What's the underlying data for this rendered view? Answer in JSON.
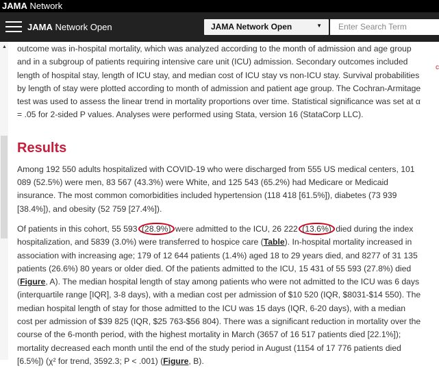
{
  "topbar": {
    "brand_bold": "JAMA",
    "brand_rest": " Network"
  },
  "navbar": {
    "journal_bold": "JAMA",
    "journal_rest": " Network Open",
    "select_value": "JAMA Network Open",
    "search_placeholder": "Enter Search Term"
  },
  "side_fragment": "c",
  "article": {
    "p1": "outcome was in-hospital mortality, which was analyzed according to the month of admission and age group and in a subgroup of patients requiring intensive care unit (ICU) admission. Secondary outcomes included length of hospital stay, length of ICU stay, and median cost of ICU stay vs non-ICU stay. Survival probabilities by length of stay were plotted according to month of admission and patient age group. The Cochran-Armitage test was used to assess the linear trend in mortality proportions over time. Statistical significance was set at α = .05 for 2-sided P values. Analyses were performed using Stata, version 16 (StataCorp LLC).",
    "results_heading": "Results",
    "p2": "Among 192 550 adults hospitalized with COVID-19 who were discharged from 555 US medical centers, 101 089 (52.5%) were men, 83 567 (43.3%) were White, and 125 543 (65.2%) had Medicare or Medicaid insurance. The most common comorbidities included hypertension (118 418 [61.5%]), diabetes (73 939 [38.4%]), and obesity (52 759 [27.4%]).",
    "p3": {
      "a": "Of patients in this cohort, 55 593 ",
      "circle1": "(28.9%)",
      "b": " were admitted to the ICU, 26 222 ",
      "circle2": "(13.6%)",
      "c": " died during the index hospitalization, and 5839 (3.0%) were transferred to hospice care (",
      "link_table": "Table",
      "d": "). In-hospital mortality increased in association with increasing age; 179 of 12 644 patients (1.4%) aged 18 to 29 years died, and 8277 of 31 135 patients (26.6%) 80 years or older died. Of the patients admitted to the ICU, 15 431 of 55 593 (27.8%) died (",
      "link_figure_a": "Figure",
      "e": ", A). The median hospital length of stay among patients who were not admitted to the ICU was 6 days (interquartile range [IQR], 3-8 days), with a median cost per admission of $10 520 (IQR, $8031-$14 550). The median hospital length of stay for those admitted to the ICU was 15 days (IQR, 6-20 days), with a median cost per admission of $39 825 (IQR, $25 763-$56 804). There was a significant reduction in mortality over the course of the 6-month period, with the highest mortality in March (3657 of 16 517 patients died [22.1%]); mortality decreased each month until the end of the study period in August (1154 of 17 776 patients died [6.5%]) (χ² for trend, 3592.3; P < .001) (",
      "link_figure_b": "Figure",
      "f": ", B)."
    }
  }
}
